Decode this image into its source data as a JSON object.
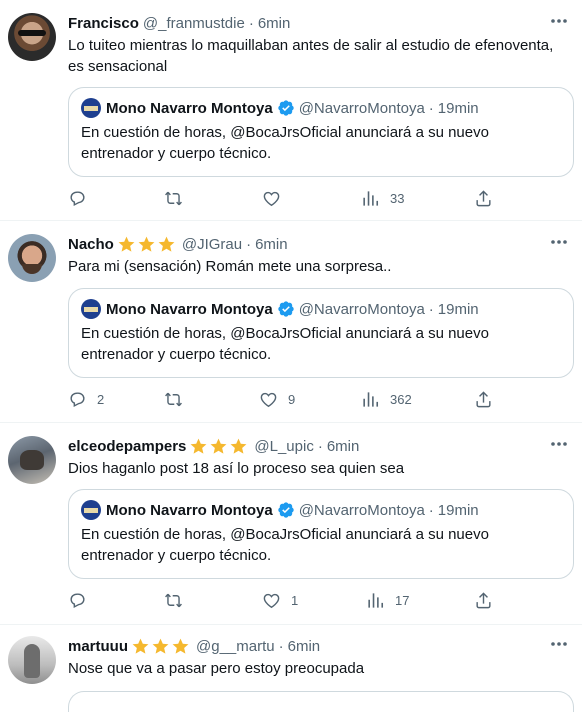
{
  "tweets": [
    {
      "name": "Francisco",
      "stars": 0,
      "handle": "@_franmustdie",
      "dot": "·",
      "time": "6min",
      "text": "Lo tuiteo mientras lo maquillaban antes de salir al estudio de efenoventa, es sensacional",
      "quote": {
        "name": "Mono Navarro Montoya",
        "handle": "@NavarroMontoya",
        "dot": "·",
        "time": "19min",
        "text": "En cuestión de horas, @BocaJrsOficial anunciará a su nuevo entrenador y cuerpo técnico."
      },
      "replies": "",
      "retweets": "",
      "likes": "",
      "views": "33"
    },
    {
      "name": "Nacho",
      "stars": 3,
      "handle": "@JIGrau",
      "dot": "·",
      "time": "6min",
      "text": "Para mi (sensación) Román mete una sorpresa..",
      "quote": {
        "name": "Mono Navarro Montoya",
        "handle": "@NavarroMontoya",
        "dot": "·",
        "time": "19min",
        "text": "En cuestión de horas, @BocaJrsOficial anunciará a su nuevo entrenador y cuerpo técnico."
      },
      "replies": "2",
      "retweets": "",
      "likes": "9",
      "views": "362"
    },
    {
      "name": "elceodepampers",
      "stars": 3,
      "handle": "@L_upic",
      "dot": "·",
      "time": "6min",
      "text": "Dios haganlo post 18 así lo proceso sea quien sea",
      "quote": {
        "name": "Mono Navarro Montoya",
        "handle": "@NavarroMontoya",
        "dot": "·",
        "time": "19min",
        "text": "En cuestión de horas, @BocaJrsOficial anunciará a su nuevo entrenador y cuerpo técnico."
      },
      "replies": "",
      "retweets": "",
      "likes": "1",
      "views": "17"
    },
    {
      "name": "martuuu",
      "stars": 3,
      "handle": "@g__martu",
      "dot": "·",
      "time": "6min",
      "text": "Nose que va a pasar pero estoy preocupada"
    }
  ],
  "icons": {
    "star": "star-icon",
    "verified": "verified-badge-icon",
    "reply": "reply-icon",
    "retweet": "retweet-icon",
    "like": "like-icon",
    "views": "views-icon",
    "share": "share-icon",
    "more": "more-icon"
  },
  "colors": {
    "star": "#f5b82e",
    "verified": "#1d9bf0",
    "secondary_text": "#536471",
    "border": "#cfd9de"
  }
}
